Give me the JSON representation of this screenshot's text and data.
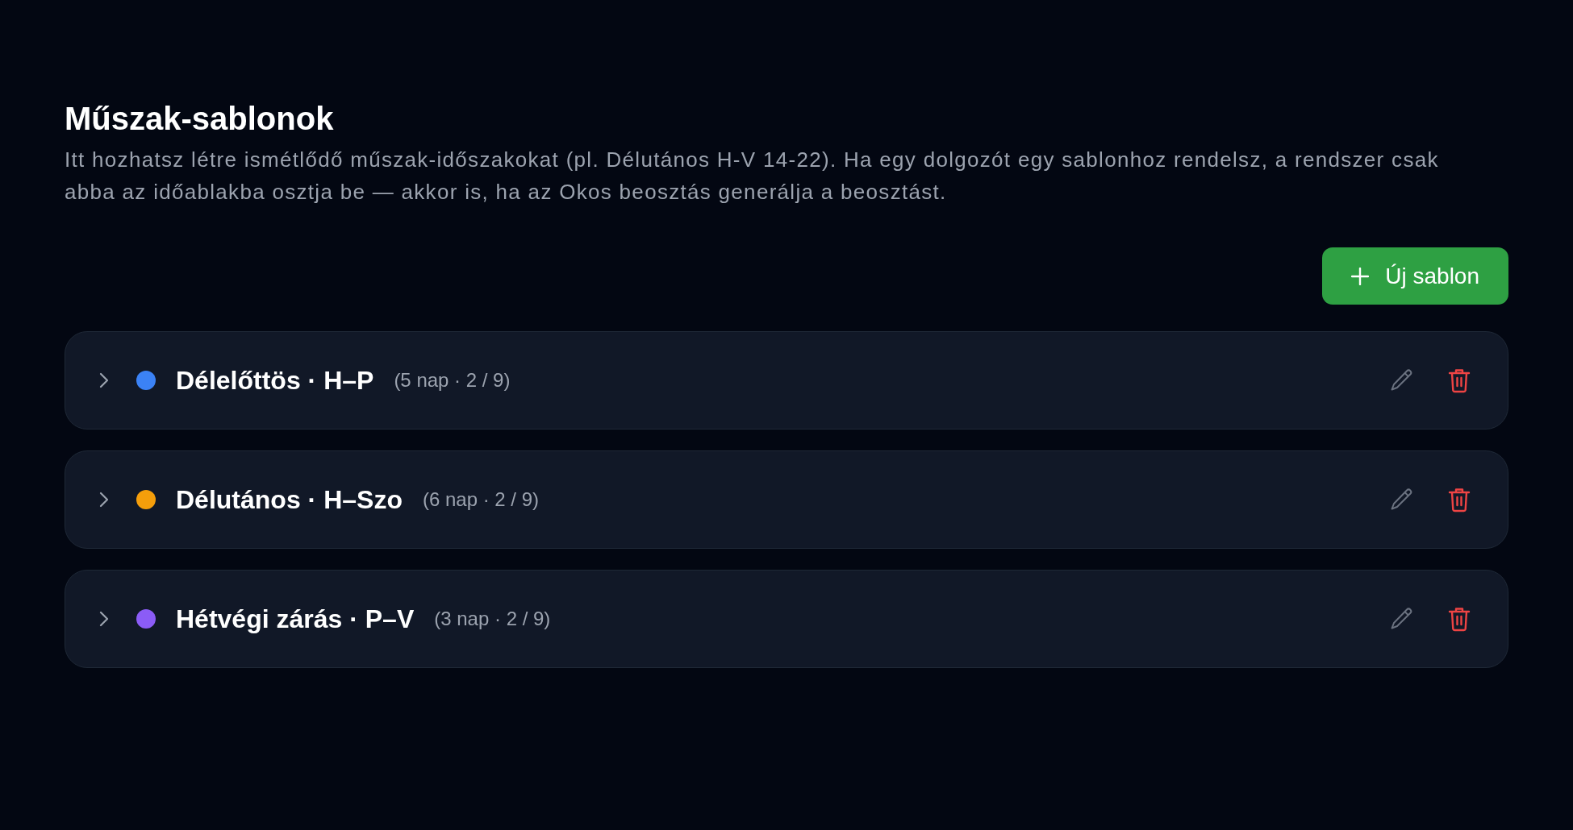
{
  "header": {
    "title": "Műszak-sablonok",
    "description": "Itt hozhatsz létre ismétlődő műszak-időszakokat (pl. Délutános H-V 14-22). Ha egy dolgozót egy sablonhoz rendelsz, a rendszer csak abba az időablakba osztja be — akkor is, ha az Okos beosztás generálja a beosztást."
  },
  "new_template_button": {
    "label": "Új sablon"
  },
  "templates": [
    {
      "name": "Délelőttös · H–P",
      "meta": "(5 nap · 2 / 9)",
      "color": "#3b82f6",
      "expanded": false
    },
    {
      "name": "Délutános · H–Szo",
      "meta": "(6 nap · 2 / 9)",
      "color": "#f59e0b",
      "expanded": false
    },
    {
      "name": "Hétvégi zárás · P–V",
      "meta": "(3 nap · 2 / 9)",
      "color": "#8b5cf6",
      "expanded": false
    }
  ]
}
